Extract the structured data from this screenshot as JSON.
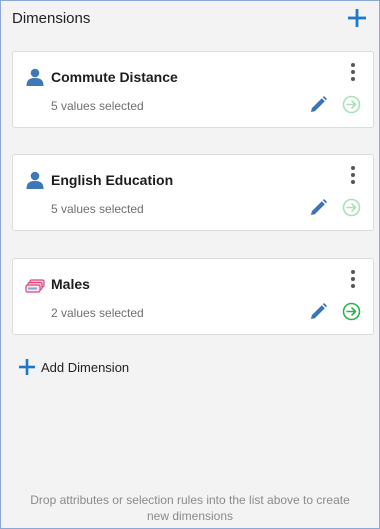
{
  "header": {
    "title": "Dimensions",
    "add_icon": "plus-icon"
  },
  "cards": [
    {
      "title": "Commute Distance",
      "subtitle": "5 values selected",
      "icon": "person-icon",
      "go_active": false
    },
    {
      "title": "English Education",
      "subtitle": "5 values selected",
      "icon": "person-icon",
      "go_active": false
    },
    {
      "title": "Males",
      "subtitle": "2 values selected",
      "icon": "selection-stack-icon",
      "go_active": true
    }
  ],
  "add_dimension": {
    "label": "Add Dimension"
  },
  "footer": {
    "hint": "Drop attributes or selection rules into the list above to create new dimensions"
  },
  "colors": {
    "accent_blue": "#1e78c8",
    "person_blue": "#3f78b8",
    "edit_blue": "#3a73b6",
    "go_active": "#2bb24c",
    "go_inactive": "#a9e2b6",
    "selection_pink": "#e0457a"
  }
}
